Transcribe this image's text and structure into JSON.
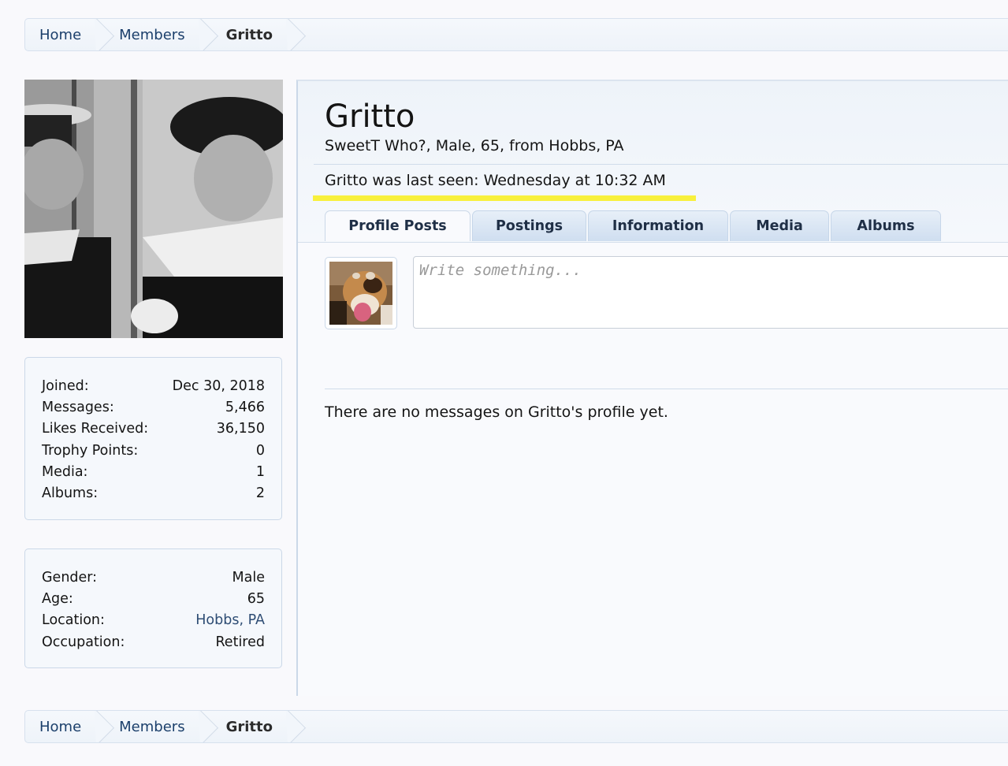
{
  "breadcrumb": {
    "items": [
      {
        "label": "Home"
      },
      {
        "label": "Members"
      },
      {
        "label": "Gritto"
      }
    ]
  },
  "profile": {
    "name": "Gritto",
    "tagline": "SweetT Who?, Male, 65, from Hobbs, PA",
    "last_seen": "Gritto was last seen: Wednesday at 10:32 AM",
    "highlight_color": "#f8f03c"
  },
  "stats": [
    {
      "label": "Joined:",
      "value": "Dec 30, 2018"
    },
    {
      "label": "Messages:",
      "value": "5,466"
    },
    {
      "label": "Likes Received:",
      "value": "36,150"
    },
    {
      "label": "Trophy Points:",
      "value": "0"
    },
    {
      "label": "Media:",
      "value": "1"
    },
    {
      "label": "Albums:",
      "value": "2"
    }
  ],
  "about": [
    {
      "label": "Gender:",
      "value": "Male"
    },
    {
      "label": "Age:",
      "value": "65"
    },
    {
      "label": "Location:",
      "value": "Hobbs, PA"
    },
    {
      "label": "Occupation:",
      "value": "Retired"
    }
  ],
  "tabs": [
    {
      "label": "Profile Posts",
      "active": true
    },
    {
      "label": "Postings"
    },
    {
      "label": "Information"
    },
    {
      "label": "Media"
    },
    {
      "label": "Albums"
    }
  ],
  "compose": {
    "placeholder": "Write something..."
  },
  "empty_message": "There are no messages on Gritto's profile yet.",
  "colors": {
    "link": "#2e4d74",
    "border": "#cbd8e8"
  }
}
